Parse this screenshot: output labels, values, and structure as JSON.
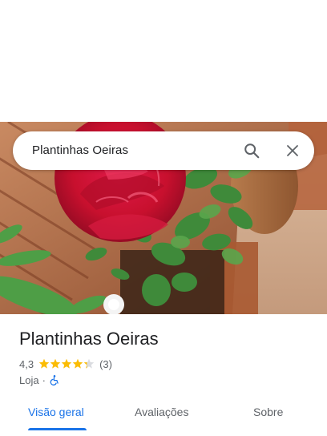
{
  "search": {
    "query": "Plantinhas Oeiras",
    "search_icon": "search-icon",
    "close_icon": "close-icon"
  },
  "place": {
    "name": "Plantinhas Oeiras",
    "rating": "4,3",
    "rating_value": 4.3,
    "stars_max": 5,
    "reviews": "(3)",
    "category": "Loja",
    "separator": "·",
    "accessibility_icon": "wheelchair-icon"
  },
  "tabs": [
    {
      "label": "Visão geral",
      "active": true
    },
    {
      "label": "Avaliações",
      "active": false
    },
    {
      "label": "Sobre",
      "active": false
    }
  ],
  "colors": {
    "accent": "#1a73e8",
    "star": "#fbbc04",
    "text_primary": "#202124",
    "text_secondary": "#5f6368"
  }
}
